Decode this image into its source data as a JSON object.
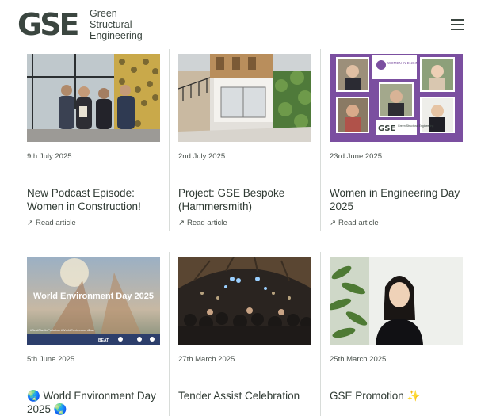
{
  "brand": {
    "mark": "GSE",
    "name_lines": [
      "Green",
      "Structural",
      "Engineering"
    ]
  },
  "articles": [
    {
      "date": "9th July 2025",
      "title": "New Podcast Episode: Women in Construction!",
      "link": "Read article"
    },
    {
      "date": "2nd July 2025",
      "title": "Project: GSE Bespoke (Hammersmith)",
      "link": "Read article"
    },
    {
      "date": "23rd June 2025",
      "title": "Women in Engineering Day 2025",
      "link": "Read article"
    },
    {
      "date": "5th June 2025",
      "title": "🌏 World Environment Day 2025 🌏"
    },
    {
      "date": "27th March 2025",
      "title": "Tender Assist Celebration"
    },
    {
      "date": "25th March 2025",
      "title": "GSE Promotion ✨"
    }
  ],
  "thumb_text": {
    "wed_title": "World Environment Day 2025",
    "wed_hashtags": "#BeatPlasticPollution #WorldEnvironmentDay",
    "wed_badge": "BEAT",
    "winel_header": "WOMEN IN ENGINEERING 23 JUNE 2025",
    "winel_brand": "GSE",
    "winel_brand_sub": "Green Structural Engineering"
  },
  "colors": {
    "purple": "#7b4fa0",
    "text": "#2f3a33",
    "divider": "#d8dcd9"
  }
}
